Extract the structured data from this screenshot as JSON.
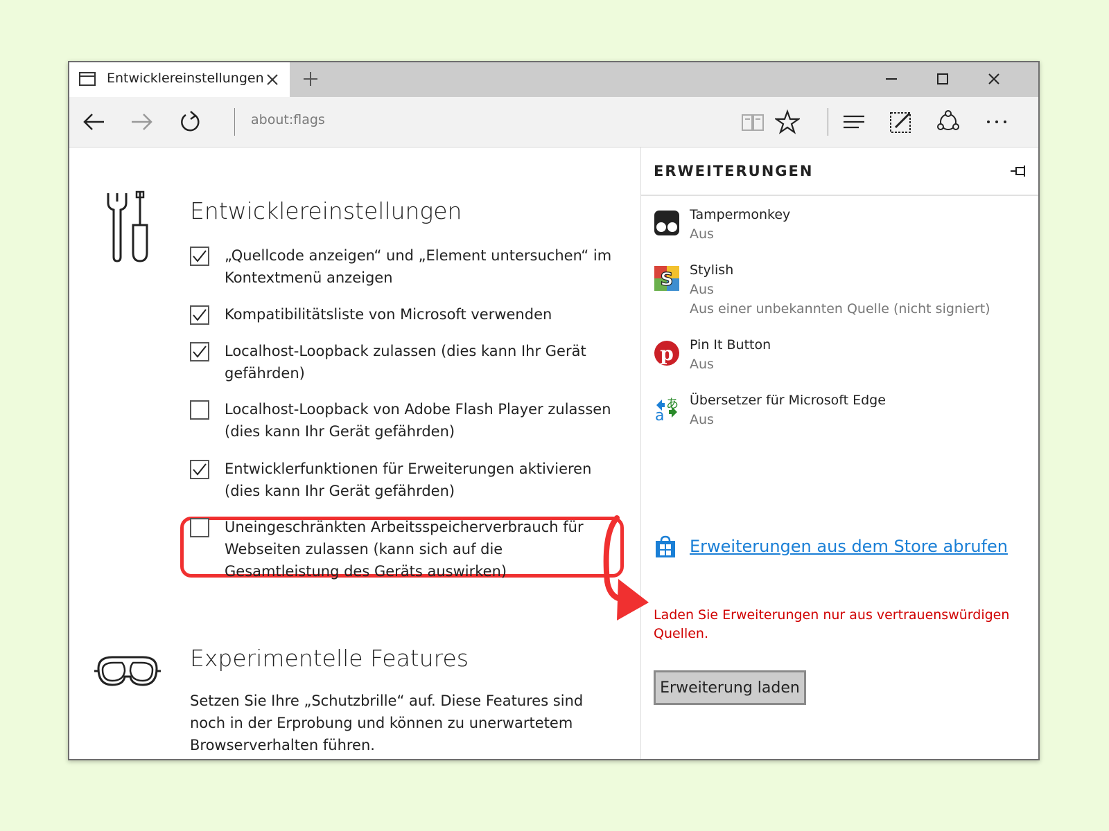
{
  "tab": {
    "title": "Entwicklereinstellungen"
  },
  "address": {
    "url": "about:flags"
  },
  "settings": {
    "title": "Entwicklereinstellungen",
    "options": [
      {
        "label": "„Quellcode anzeigen“ und „Element untersuchen“ im Kontextmenü anzeigen",
        "checked": true
      },
      {
        "label": "Kompatibilitätsliste von Microsoft verwenden",
        "checked": true
      },
      {
        "label": "Localhost-Loopback zulassen (dies kann Ihr Gerät gefährden)",
        "checked": true
      },
      {
        "label": "Localhost-Loopback von Adobe Flash Player zulassen (dies kann Ihr Gerät gefährden)",
        "checked": false
      },
      {
        "label": "Entwicklerfunktionen für Erweiterungen aktivieren (dies kann Ihr Gerät gefährden)",
        "checked": true
      },
      {
        "label": "Uneingeschränkten Arbeitsspeicherverbrauch für Webseiten zulassen (kann sich auf die Gesamtleistung des Geräts auswirken)",
        "checked": false
      }
    ]
  },
  "experimental": {
    "title": "Experimentelle Features",
    "description": "Setzen Sie Ihre „Schutzbrille“ auf. Diese Features sind noch in der Erprobung und können zu unerwartetem Browserverhalten führen."
  },
  "panel": {
    "title": "ERWEITERUNGEN",
    "extensions": [
      {
        "name": "Tampermonkey",
        "status": "Aus",
        "note": ""
      },
      {
        "name": "Stylish",
        "status": "Aus",
        "note": "Aus einer unbekannten Quelle (nicht signiert)"
      },
      {
        "name": "Pin It Button",
        "status": "Aus",
        "note": ""
      },
      {
        "name": "Übersetzer für Microsoft Edge",
        "status": "Aus",
        "note": ""
      }
    ],
    "store_link": "Erweiterungen aus dem Store abrufen",
    "warning": "Laden Sie Erweiterungen nur aus vertrauenswürdigen Quellen.",
    "load_button": "Erweiterung laden"
  },
  "colors": {
    "highlight": "#f03030",
    "link": "#1a7fd6",
    "warning": "#d00000",
    "background": "#eefbdc"
  }
}
